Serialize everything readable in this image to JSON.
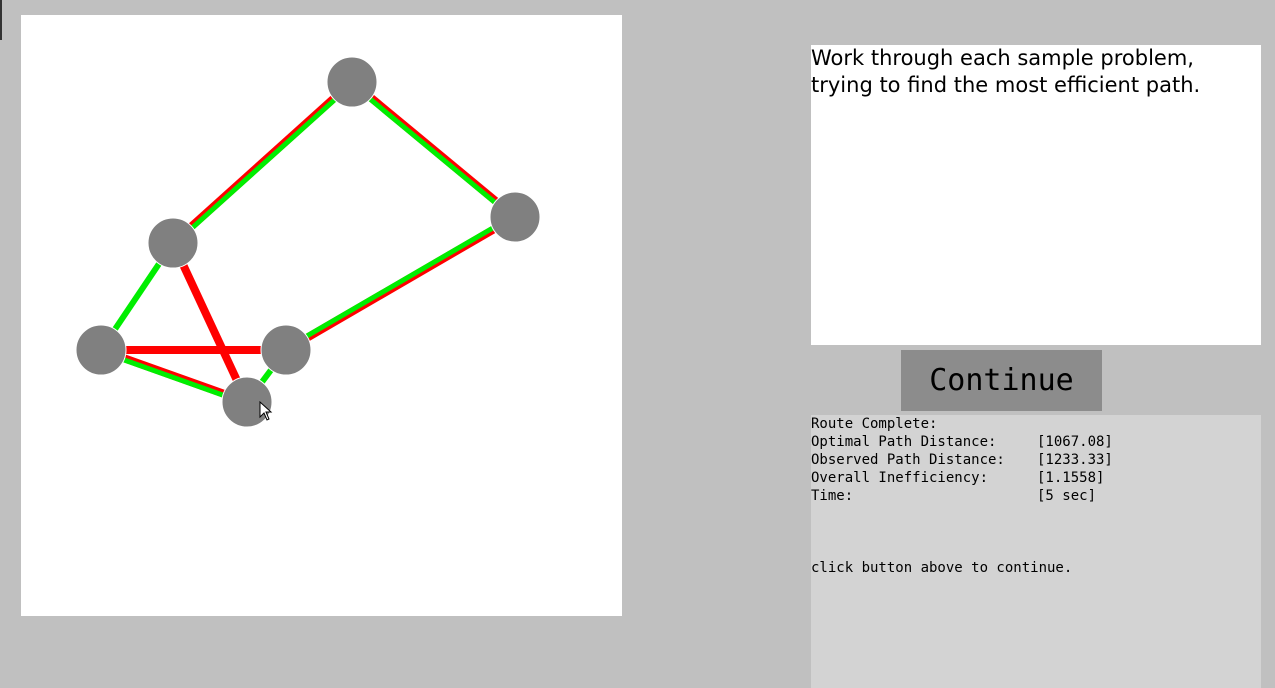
{
  "instructions": {
    "lines": [
      "Work through each sample problem,",
      "trying to find the most efficient path."
    ]
  },
  "continue_button": {
    "label": "Continue"
  },
  "results": {
    "heading": "Route Complete:",
    "rows": [
      {
        "label": "Optimal Path Distance:",
        "value": "[1067.08]"
      },
      {
        "label": "Observed Path Distance:",
        "value": "[1233.33]"
      },
      {
        "label": "Overall Inefficiency:",
        "value": "[1.1558]"
      },
      {
        "label": "Time:",
        "value": "[5 sec]"
      }
    ],
    "footer": "click button above to continue."
  },
  "colors": {
    "node": "#808080",
    "optimal_edge": "#00ee00",
    "observed_edge": "#ff0000",
    "canvas_bg": "#ffffff",
    "app_bg": "#c0c0c0"
  },
  "graph": {
    "nodes": [
      {
        "id": "top"
      },
      {
        "id": "right"
      },
      {
        "id": "upper-left"
      },
      {
        "id": "left"
      },
      {
        "id": "center"
      },
      {
        "id": "bottom"
      }
    ],
    "edges": [
      {
        "from": "upper-left",
        "to": "top",
        "optimal": true,
        "observed": true
      },
      {
        "from": "top",
        "to": "right",
        "optimal": true,
        "observed": true
      },
      {
        "from": "right",
        "to": "center",
        "optimal": true,
        "observed": true
      },
      {
        "from": "left",
        "to": "bottom",
        "optimal": true,
        "observed": true
      },
      {
        "from": "upper-left",
        "to": "left",
        "optimal": true,
        "observed": false
      },
      {
        "from": "center",
        "to": "bottom",
        "optimal": true,
        "observed": false
      },
      {
        "from": "left",
        "to": "center",
        "optimal": false,
        "observed": true
      },
      {
        "from": "upper-left",
        "to": "bottom",
        "optimal": false,
        "observed": true
      }
    ]
  }
}
